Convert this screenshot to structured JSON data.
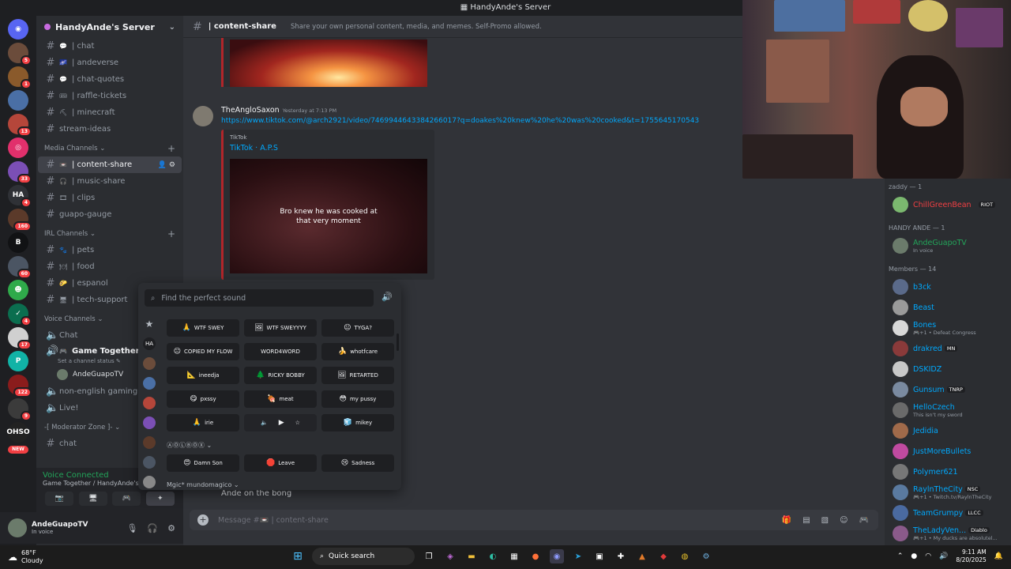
{
  "window": {
    "title": "HandyAnde's Server"
  },
  "server_rail": [
    {
      "icon": "discord-icon",
      "color": "#5865f2",
      "glyph": "◉"
    },
    {
      "icon": "server-icon",
      "color": "#6b4c3b",
      "badge": "5"
    },
    {
      "icon": "server-icon",
      "color": "#8a5a2b",
      "badge": "1"
    },
    {
      "icon": "server-icon",
      "color": "#4a6fa5",
      "badge": ""
    },
    {
      "icon": "server-icon",
      "color": "#b5463a",
      "badge": "13"
    },
    {
      "icon": "server-icon",
      "color": "#e1306c",
      "glyph": "◎"
    },
    {
      "icon": "server-icon",
      "color": "#7b4fb5",
      "badge": "33"
    },
    {
      "icon": "server-icon",
      "color": "#2f3136",
      "glyph": "HA",
      "badge": "4"
    },
    {
      "icon": "server-icon",
      "color": "#5b3a2a",
      "badge": "160"
    },
    {
      "icon": "server-icon",
      "color": "#111214",
      "glyph": "B"
    },
    {
      "icon": "server-icon",
      "color": "#4b5563",
      "badge": "60"
    },
    {
      "icon": "server-icon",
      "color": "#2faa4a",
      "glyph": "☻"
    },
    {
      "icon": "server-icon",
      "color": "#0b6e4f",
      "glyph": "✓",
      "badge": "4"
    },
    {
      "icon": "server-icon",
      "color": "#d0d0d0",
      "badge": "17"
    },
    {
      "icon": "server-icon",
      "color": "#11b3a6",
      "glyph": "P"
    },
    {
      "icon": "server-icon",
      "color": "#8a1c1c",
      "badge": "122"
    },
    {
      "icon": "server-icon",
      "color": "#3b3b3b",
      "badge": "9"
    },
    {
      "icon": "server-icon",
      "color": "#222",
      "glyph": "OHSO"
    }
  ],
  "server_rail_new": "NEW",
  "server": {
    "name": "HandyAnde's Server"
  },
  "channels_top": [
    {
      "name": "| chat",
      "emoji": "💬"
    },
    {
      "name": "| andeverse",
      "emoji": "🌌"
    },
    {
      "name": "| chat-quotes",
      "emoji": "💬"
    },
    {
      "name": "| raffle-tickets",
      "emoji": "🎟"
    },
    {
      "name": "| minecraft",
      "emoji": "⛏"
    },
    {
      "name": "stream-ideas",
      "emoji": ""
    }
  ],
  "media_category": "Media Channels",
  "media_channels": [
    {
      "name": "| content-share",
      "emoji": "📼",
      "active": true
    },
    {
      "name": "| music-share",
      "emoji": "🎧"
    },
    {
      "name": "| clips",
      "emoji": "🎞"
    },
    {
      "name": "guapo-gauge",
      "emoji": ""
    }
  ],
  "irl_category": "IRL Channels",
  "irl_channels": [
    {
      "name": "| pets",
      "emoji": "🐾"
    },
    {
      "name": "| food",
      "emoji": "🍽"
    },
    {
      "name": "| espanol",
      "emoji": "🌮"
    },
    {
      "name": "| tech-support",
      "emoji": "🖥"
    }
  ],
  "voice_category": "Voice Channels",
  "voice_channels": {
    "chat": "Chat",
    "game_together": "Game Together",
    "game_status": "Set a channel status ✎",
    "user": "AndeGuapoTV",
    "non_english": "non-english gaming",
    "live": "Live!"
  },
  "mod_category": "-[ Moderator Zone ]-",
  "mod_channel": "chat",
  "voice_connected": {
    "title": "Voice Connected",
    "subtitle": "Game Together / HandyAnde's Server"
  },
  "user_panel": {
    "name": "AndeGuapoTV",
    "status": "In voice"
  },
  "header": {
    "channel": "| content-share",
    "topic": "Share your own personal content, media, and memes. Self-Promo allowed."
  },
  "message": {
    "author": "TheAngloSaxon",
    "time": "Yesterday at 7:13 PM",
    "link": "https://www.tiktok.com/@arch2921/video/7469944643384266017?q=doakes%20knew%20he%20was%20cooked&t=1755645170543",
    "embed_provider": "TikTok",
    "embed_title": "TikTok · A.P.S",
    "video_caption_1": "Bro knew he was cooked at",
    "video_caption_2": "that very moment"
  },
  "last_message": "Ande on the bong",
  "composer": {
    "placeholder": "Message #📼 | content-share"
  },
  "soundboard": {
    "search_placeholder": "Find the perfect sound",
    "rows": [
      [
        {
          "label": "WTF SWEY",
          "emoji": "🙏"
        },
        {
          "label": "WTF SWEYYYY",
          "emoji": "🖼"
        },
        {
          "label": "TYGA?",
          "emoji": "😐"
        }
      ],
      [
        {
          "label": "COPIED MY FLOW",
          "emoji": "😐"
        },
        {
          "label": "WORD4WORD",
          "emoji": ""
        },
        {
          "label": "whotfcare",
          "emoji": "🍌"
        }
      ],
      [
        {
          "label": "ineedja",
          "emoji": "📐"
        },
        {
          "label": "RICKY BOBBY",
          "emoji": "🌲"
        },
        {
          "label": "RETARTED",
          "emoji": "🖼"
        }
      ],
      [
        {
          "label": "pxssy",
          "emoji": "😋"
        },
        {
          "label": "meat",
          "emoji": "🍖"
        },
        {
          "label": "my pussy",
          "emoji": "😳"
        }
      ],
      [
        {
          "label": "irie",
          "emoji": "🙏"
        },
        {
          "label": "",
          "emoji": "▶"
        },
        {
          "label": "mikey",
          "emoji": "🧊"
        }
      ]
    ],
    "section2_title": "ⒶⓄⓁⒷⓄⓍ",
    "section2_row": [
      {
        "label": "Damn Son",
        "emoji": "😍"
      },
      {
        "label": "Leave",
        "emoji": "🛑"
      },
      {
        "label": "Sadness",
        "emoji": "😢"
      }
    ],
    "section3_title": "Mgic* mundomagico"
  },
  "members": {
    "cat1": "zaddy — 1",
    "m1": {
      "name": "ChillGreenBean",
      "tag": "RIOT",
      "color": "#f23f43"
    },
    "cat2": "HANDY ANDE — 1",
    "m2": {
      "name": "AndeGuapoTV",
      "sub": "In voice",
      "color": "#23a55a"
    },
    "cat3": "Members — 14",
    "list": [
      {
        "name": "b3ck",
        "sub": "",
        "tag": "",
        "color": "#00a8fc"
      },
      {
        "name": "Beast",
        "sub": "",
        "tag": "",
        "color": "#00a8fc"
      },
      {
        "name": "Bones",
        "sub": "🎮+1 • Defeat Congress",
        "tag": "",
        "color": "#00a8fc"
      },
      {
        "name": "drakred",
        "sub": "",
        "tag": "MN",
        "color": "#00a8fc"
      },
      {
        "name": "DSKIDZ",
        "sub": "",
        "tag": "",
        "color": "#00a8fc"
      },
      {
        "name": "Gunsum",
        "sub": "",
        "tag": "TNRP",
        "color": "#00a8fc"
      },
      {
        "name": "HelloCzech",
        "sub": "This isn't my sword",
        "tag": "",
        "color": "#00a8fc"
      },
      {
        "name": "Jedidia",
        "sub": "",
        "tag": "",
        "color": "#00a8fc"
      },
      {
        "name": "JustMoreBullets",
        "sub": "",
        "tag": "",
        "color": "#00a8fc"
      },
      {
        "name": "Polymer621",
        "sub": "",
        "tag": "",
        "color": "#00a8fc"
      },
      {
        "name": "RaylnTheCity",
        "sub": "🎮+1 • Twitch.tv/RaylnTheCity",
        "tag": "NSC",
        "color": "#00a8fc"
      },
      {
        "name": "TeamGrumpy",
        "sub": "",
        "tag": "LLCC",
        "color": "#00a8fc"
      },
      {
        "name": "TheLadyVen...",
        "sub": "🎮+1 • My ducks are absolutel...",
        "tag": "Diablo",
        "color": "#00a8fc"
      }
    ]
  },
  "taskbar": {
    "temp": "68°F",
    "cond": "Cloudy",
    "search": "Quick search",
    "time": "9:11 AM",
    "date": "8/20/2025"
  }
}
